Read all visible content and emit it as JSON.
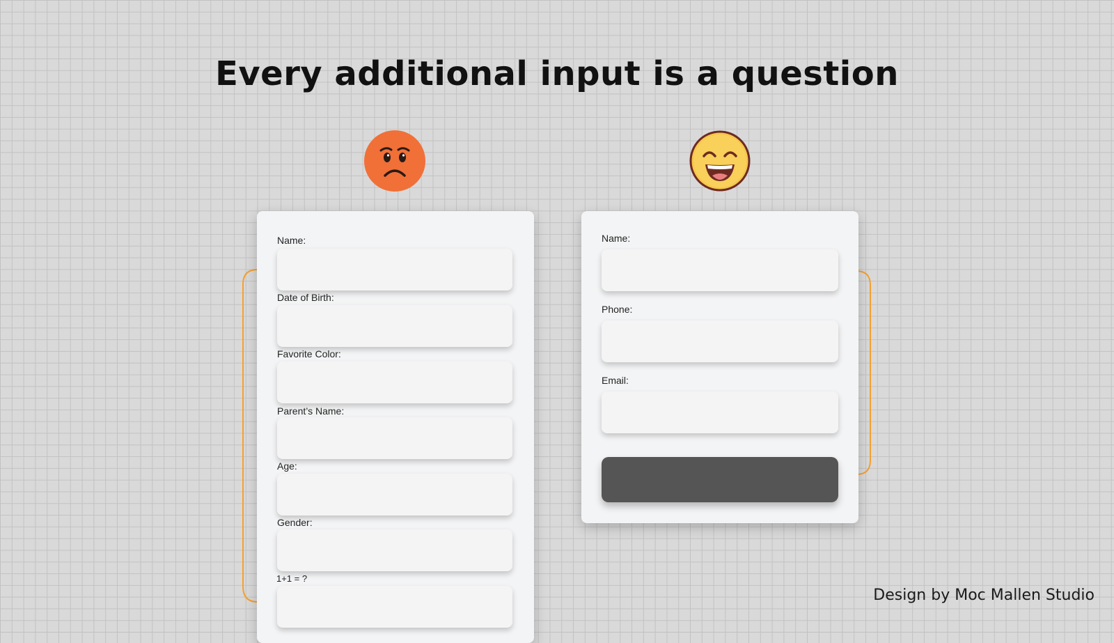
{
  "headline": "Every additional input is a question",
  "left_form": {
    "mood_icon": "frowning-face-icon",
    "fields": [
      {
        "label": "Name:",
        "value": ""
      },
      {
        "label": "Date of Birth:",
        "value": ""
      },
      {
        "label": "Favorite Color:",
        "value": ""
      },
      {
        "label": "Parent’s Name:",
        "value": ""
      },
      {
        "label": "Age:",
        "value": ""
      },
      {
        "label": "Gender:",
        "value": ""
      },
      {
        "label": "1+1 = ?",
        "value": ""
      }
    ]
  },
  "right_form": {
    "mood_icon": "grinning-face-icon",
    "fields": [
      {
        "label": "Name:",
        "value": ""
      },
      {
        "label": "Phone:",
        "value": ""
      },
      {
        "label": "Email:",
        "value": ""
      }
    ],
    "submit_label": ""
  },
  "colors": {
    "bracket": "#f5a030",
    "submit": "#555555",
    "sad_face": "#f07038",
    "happy_face": "#f6c74a"
  },
  "credit": "Design by  Moc Mallen Studio"
}
